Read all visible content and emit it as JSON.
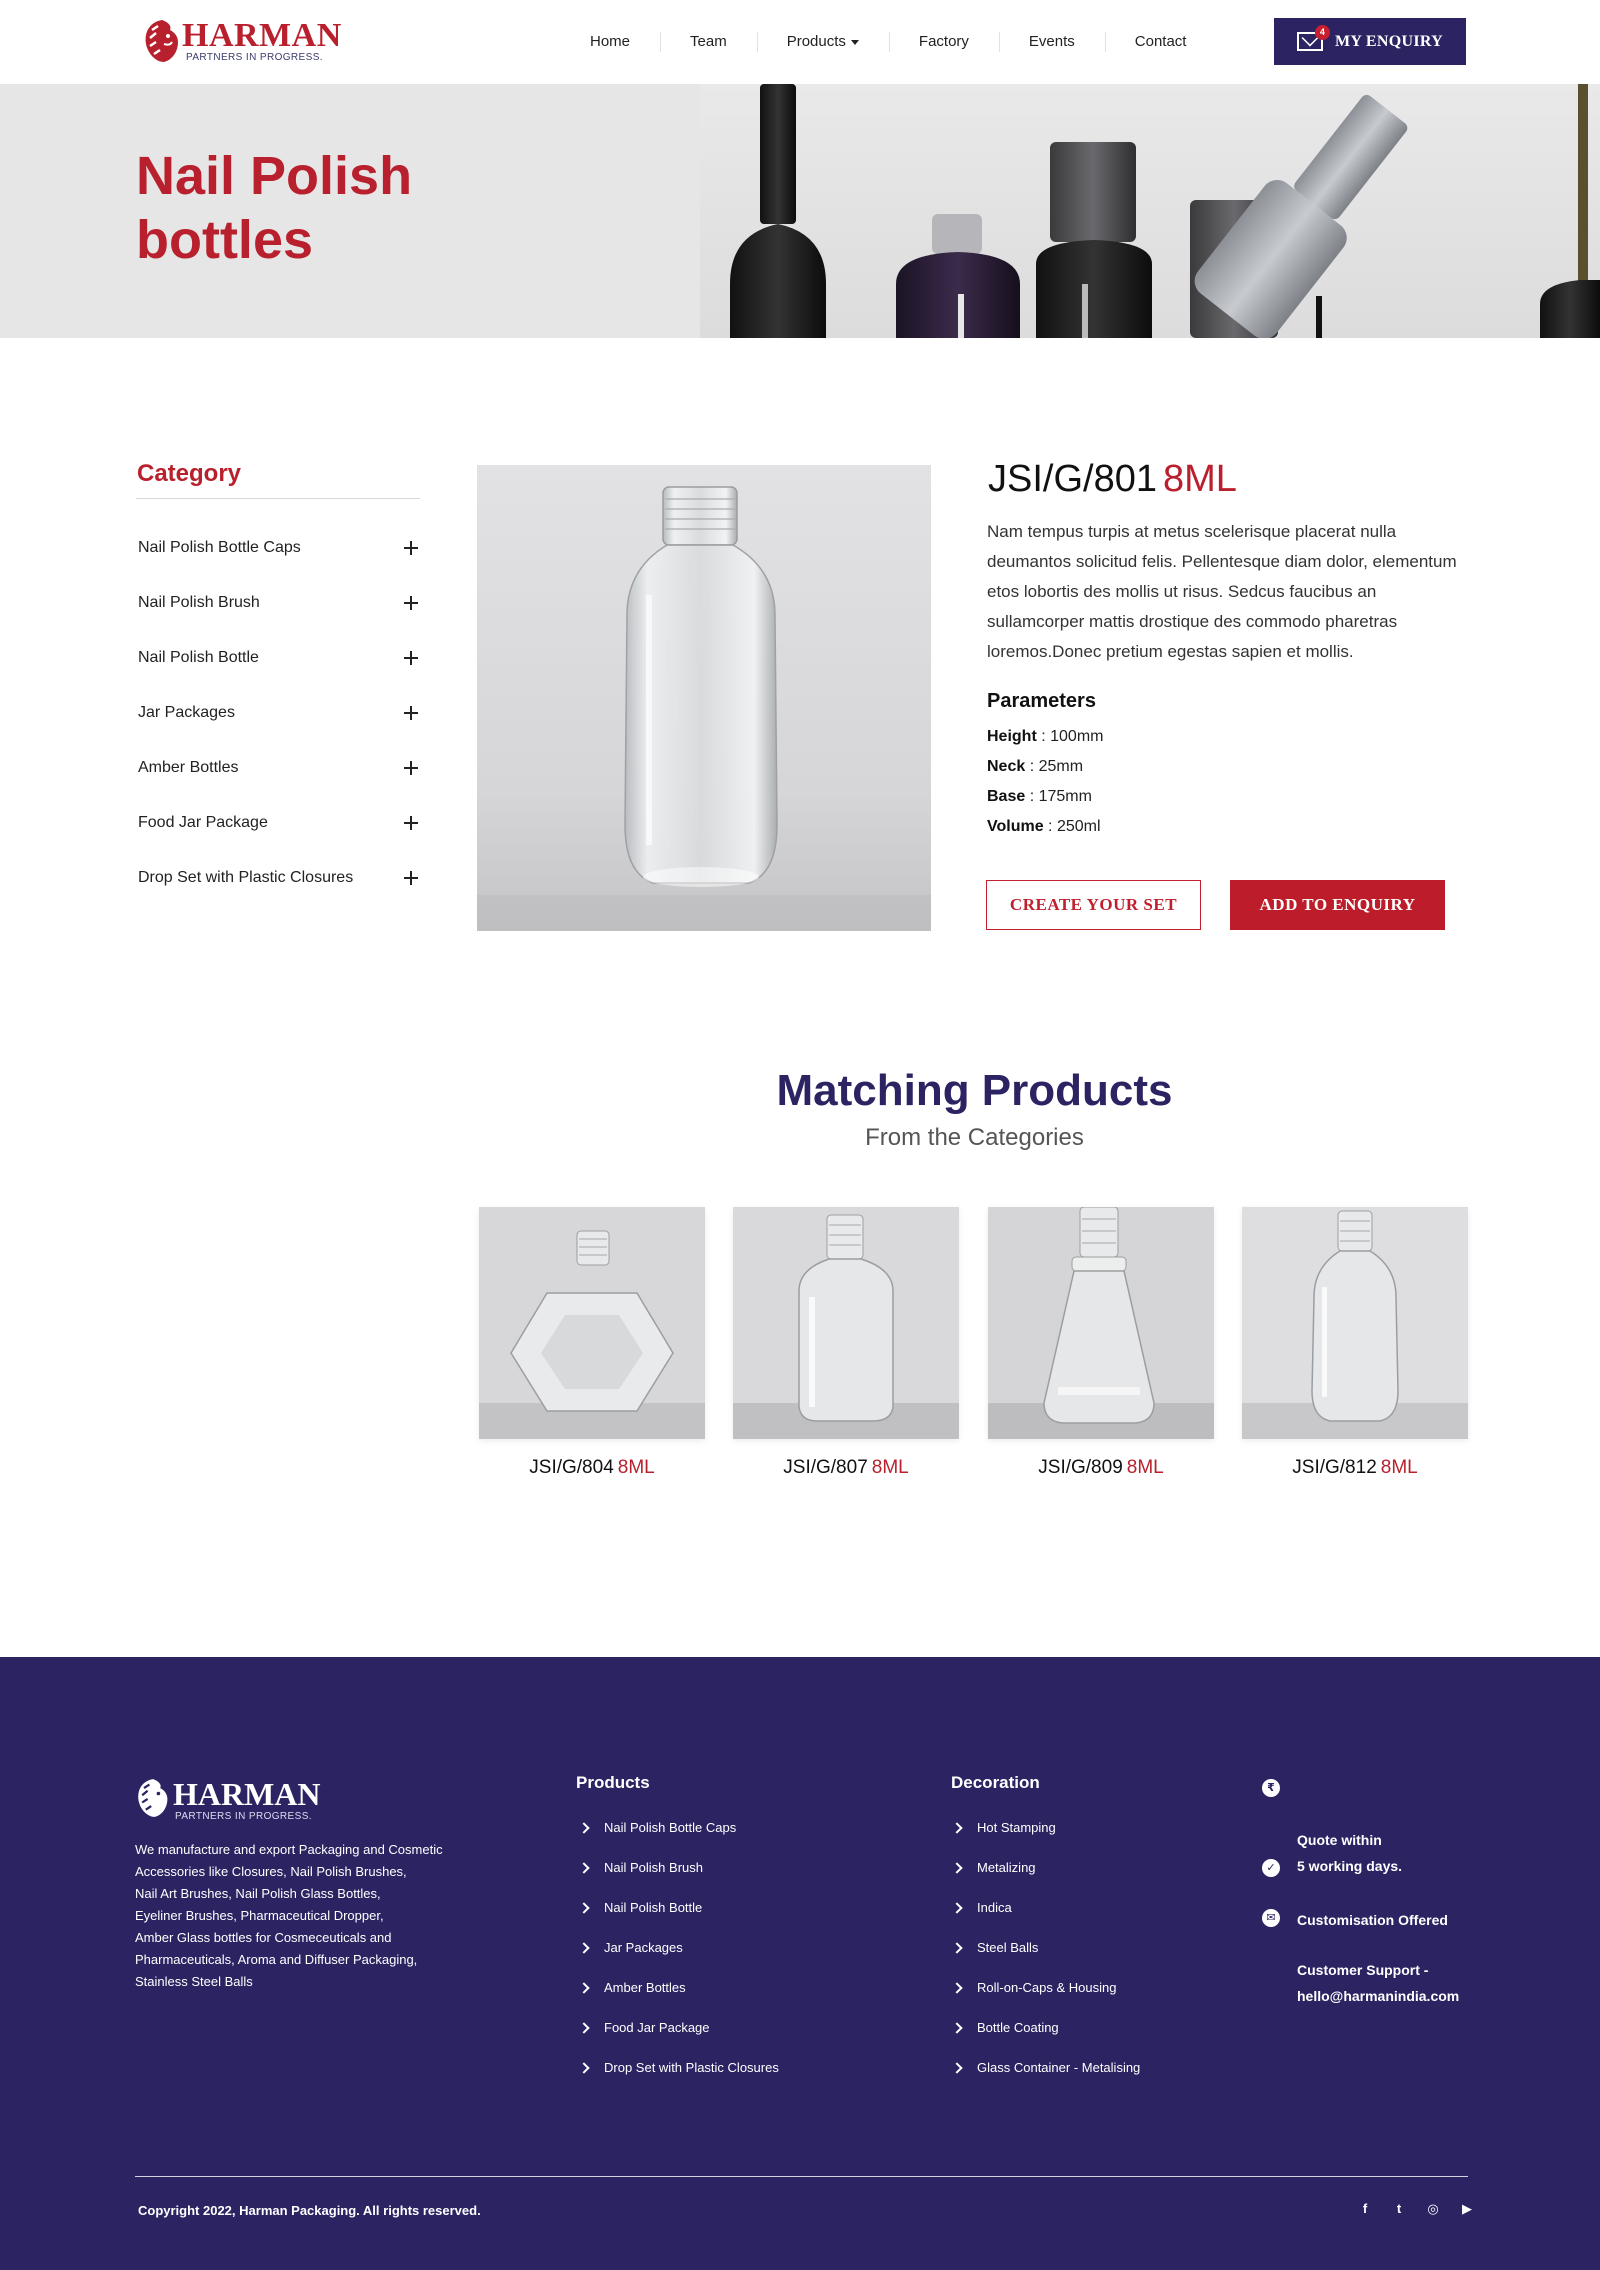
{
  "header": {
    "brand": "HARMAN",
    "tagline": "PARTNERS IN PROGRESS.",
    "nav": [
      "Home",
      "Team",
      "Products",
      "Factory",
      "Events",
      "Contact"
    ],
    "enquiry_label": "MY ENQUIRY",
    "enquiry_count": "4"
  },
  "banner": {
    "title": "Nail Polish bottles"
  },
  "sidebar": {
    "title": "Category",
    "items": [
      "Nail Polish Bottle Caps",
      "Nail Polish Brush",
      "Nail Polish Bottle",
      "Jar Packages",
      "Amber Bottles",
      "Food Jar Package",
      "Drop Set with Plastic Closures"
    ]
  },
  "product": {
    "code": "JSI/G/801",
    "size": "8ML",
    "description": "Nam tempus turpis at metus scelerisque placerat nulla deumantos solicitud felis. Pellentesque diam dolor, elementum etos lobortis des mollis ut risus. Sedcus faucibus an sullamcorper mattis drostique des commodo pharetras loremos.Donec pretium egestas sapien et mollis.",
    "params_title": "Parameters",
    "params": [
      {
        "label": "Height",
        "value": "100mm"
      },
      {
        "label": "Neck",
        "value": "25mm"
      },
      {
        "label": "Base",
        "value": "175mm"
      },
      {
        "label": "Volume",
        "value": "250ml"
      }
    ],
    "create_label": "CREATE YOUR SET",
    "add_label": "ADD TO ENQUIRY"
  },
  "matching": {
    "title": "Matching Products",
    "subtitle": "From the Categories",
    "items": [
      {
        "code": "JSI/G/804",
        "size": "8ML"
      },
      {
        "code": "JSI/G/807",
        "size": "8ML"
      },
      {
        "code": "JSI/G/809",
        "size": "8ML"
      },
      {
        "code": "JSI/G/812",
        "size": "8ML"
      }
    ]
  },
  "footer": {
    "brand": "HARMAN",
    "tagline": "PARTNERS IN PROGRESS.",
    "about": "We manufacture and export Packaging and Cosmetic\n Accessories like Closures, Nail Polish Brushes,\nNail Art Brushes, Nail Polish Glass Bottles,\nEyeliner Brushes, Pharmaceutical Dropper,\nAmber Glass bottles for Cosmeceuticals and\nPharmaceuticals, Aroma and Diffuser Packaging,\nStainless Steel Balls",
    "products_title": "Products",
    "products": [
      "Nail Polish Bottle Caps",
      "Nail Polish Brush",
      "Nail Polish Bottle",
      "Jar Packages",
      "Amber Bottles",
      "Food Jar Package",
      "Drop Set with Plastic Closures"
    ],
    "decoration_title": "Decoration",
    "decoration": [
      "Hot Stamping",
      "Metalizing",
      "Indica",
      "Steel Balls",
      "Roll-on-Caps & Housing",
      "Bottle Coating",
      "Glass Container - Metalising"
    ],
    "info": [
      {
        "icon": "rupee-icon",
        "glyph": "₹",
        "text": "Quote within\n5 working days."
      },
      {
        "icon": "badge-icon",
        "glyph": "✓",
        "text": "Customisation Offered"
      },
      {
        "icon": "chat-icon",
        "glyph": "✉",
        "text": "Customer Support -\nhello@harmanindia.com"
      }
    ],
    "copyright": "Copyright 2022, Harman Packaging. All rights reserved.",
    "socials": [
      {
        "icon": "facebook-icon",
        "glyph": "f"
      },
      {
        "icon": "twitter-icon",
        "glyph": "t"
      },
      {
        "icon": "instagram-icon",
        "glyph": "◎"
      },
      {
        "icon": "youtube-icon",
        "glyph": "▶"
      }
    ]
  },
  "colors": {
    "brand_red": "#b9202d",
    "brand_navy": "#2b2362"
  }
}
